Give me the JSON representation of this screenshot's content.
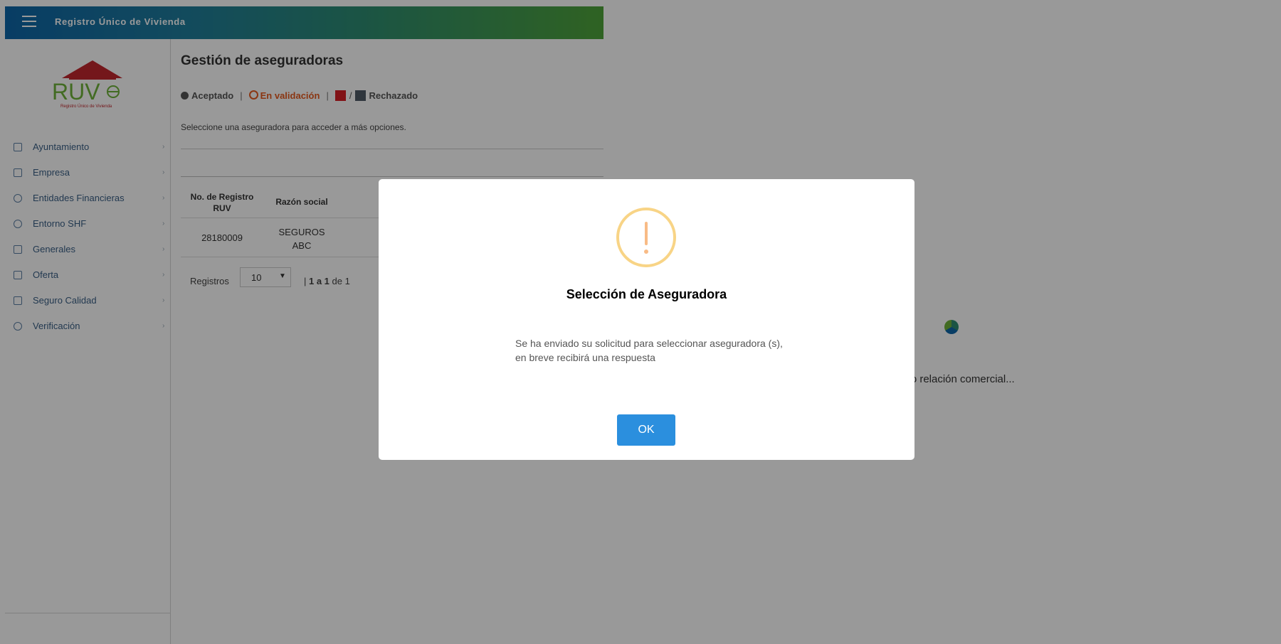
{
  "app": {
    "title": "Registro Único de Vivienda"
  },
  "logo": {
    "letters": "RUV",
    "tagline": "Registro Único de Vivienda"
  },
  "sidebar": {
    "items": [
      {
        "label": "Ayuntamiento",
        "icon": "map-icon"
      },
      {
        "label": "Empresa",
        "icon": "building-icon"
      },
      {
        "label": "Entidades Financieras",
        "icon": "binoculars-icon"
      },
      {
        "label": "Entorno SHF",
        "icon": "target-icon"
      },
      {
        "label": "Generales",
        "icon": "document-icon"
      },
      {
        "label": "Oferta",
        "icon": "house-hand-icon"
      },
      {
        "label": "Seguro Calidad",
        "icon": "shield-icon"
      },
      {
        "label": "Verificación",
        "icon": "check-circle-icon"
      }
    ]
  },
  "main": {
    "title": "Gestión de aseguradoras",
    "legend": {
      "accepted": "Aceptado",
      "separator": "|",
      "in_validation": "En validación",
      "slash": "/",
      "rejected": "Rechazado"
    },
    "instructions": "Seleccione una aseguradora para acceder a más opciones.",
    "table": {
      "headers": [
        "No. de Registro RUV",
        "Razón social"
      ],
      "rows": [
        {
          "registro": "28180009",
          "razon_social": "SEGUROS ABC"
        }
      ]
    },
    "pager": {
      "label": "Registros",
      "page_size": "10",
      "range": "1 a 1",
      "of": "de",
      "total": "1"
    }
  },
  "loading": {
    "text": "Cargando relación comercial..."
  },
  "modal": {
    "title": "Selección de Aseguradora",
    "message": "Se ha enviado su solicitud para seleccionar aseguradora (s), en breve recibirá una respuesta",
    "ok_label": "OK"
  },
  "colors": {
    "topbar_start": "#0e66a8",
    "topbar_end": "#4fa43a",
    "ok_button": "#2b8fde",
    "warning": "#f8bb86",
    "rejected_flag": "#d81f26",
    "validation": "#e65a1e",
    "sidebar_text": "#3a5f86"
  }
}
